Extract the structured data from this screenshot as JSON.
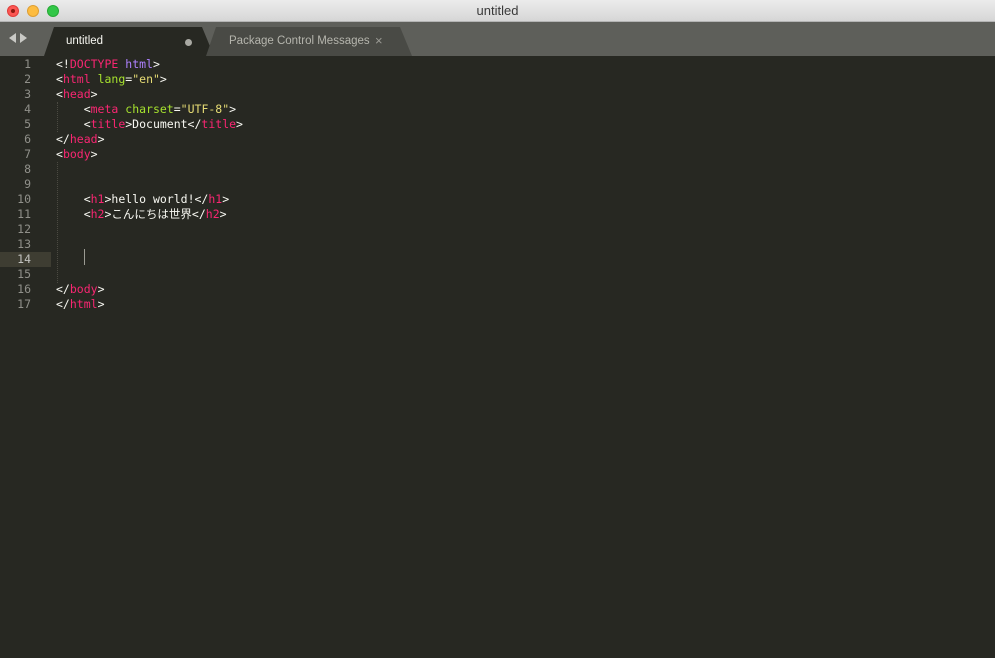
{
  "window": {
    "title": "untitled"
  },
  "tabs": [
    {
      "label": "untitled",
      "active": true,
      "dirty": true
    },
    {
      "label": "Package Control Messages",
      "active": false,
      "close_glyph": "×"
    }
  ],
  "editor": {
    "current_line": 14,
    "theme_colors": {
      "background": "#272822",
      "tag": "#f92672",
      "attr": "#a6e22e",
      "string": "#e6db74",
      "keyword": "#ae81ff",
      "text": "#f8f8f2"
    },
    "lines": [
      {
        "num": "1",
        "tokens": [
          {
            "t": "<!",
            "c": "white"
          },
          {
            "t": "DOCTYPE",
            "c": "pink"
          },
          {
            "t": " ",
            "c": "white"
          },
          {
            "t": "html",
            "c": "purple"
          },
          {
            "t": ">",
            "c": "white"
          }
        ]
      },
      {
        "num": "2",
        "tokens": [
          {
            "t": "<",
            "c": "white"
          },
          {
            "t": "html",
            "c": "pink"
          },
          {
            "t": " ",
            "c": "white"
          },
          {
            "t": "lang",
            "c": "green"
          },
          {
            "t": "=",
            "c": "white"
          },
          {
            "t": "\"en\"",
            "c": "yellow"
          },
          {
            "t": ">",
            "c": "white"
          }
        ]
      },
      {
        "num": "3",
        "tokens": [
          {
            "t": "<",
            "c": "white"
          },
          {
            "t": "head",
            "c": "pink"
          },
          {
            "t": ">",
            "c": "white"
          }
        ]
      },
      {
        "num": "4",
        "tokens": [
          {
            "t": "    <",
            "c": "white"
          },
          {
            "t": "meta",
            "c": "pink"
          },
          {
            "t": " ",
            "c": "white"
          },
          {
            "t": "charset",
            "c": "green"
          },
          {
            "t": "=",
            "c": "white"
          },
          {
            "t": "\"UTF-8\"",
            "c": "yellow"
          },
          {
            "t": ">",
            "c": "white"
          }
        ]
      },
      {
        "num": "5",
        "tokens": [
          {
            "t": "    <",
            "c": "white"
          },
          {
            "t": "title",
            "c": "pink"
          },
          {
            "t": ">Document</",
            "c": "white"
          },
          {
            "t": "title",
            "c": "pink"
          },
          {
            "t": ">",
            "c": "white"
          }
        ]
      },
      {
        "num": "6",
        "tokens": [
          {
            "t": "</",
            "c": "white"
          },
          {
            "t": "head",
            "c": "pink"
          },
          {
            "t": ">",
            "c": "white"
          }
        ]
      },
      {
        "num": "7",
        "tokens": [
          {
            "t": "<",
            "c": "white"
          },
          {
            "t": "body",
            "c": "pink"
          },
          {
            "t": ">",
            "c": "white"
          }
        ]
      },
      {
        "num": "8",
        "tokens": []
      },
      {
        "num": "9",
        "tokens": []
      },
      {
        "num": "10",
        "tokens": [
          {
            "t": "    <",
            "c": "white"
          },
          {
            "t": "h1",
            "c": "pink"
          },
          {
            "t": ">hello world!</",
            "c": "white"
          },
          {
            "t": "h1",
            "c": "pink"
          },
          {
            "t": ">",
            "c": "white"
          }
        ]
      },
      {
        "num": "11",
        "tokens": [
          {
            "t": "    <",
            "c": "white"
          },
          {
            "t": "h2",
            "c": "pink"
          },
          {
            "t": ">こんにちは世界</",
            "c": "white"
          },
          {
            "t": "h2",
            "c": "pink"
          },
          {
            "t": ">",
            "c": "white"
          }
        ]
      },
      {
        "num": "12",
        "tokens": []
      },
      {
        "num": "13",
        "tokens": []
      },
      {
        "num": "14",
        "tokens": []
      },
      {
        "num": "15",
        "tokens": []
      },
      {
        "num": "16",
        "tokens": [
          {
            "t": "</",
            "c": "white"
          },
          {
            "t": "body",
            "c": "pink"
          },
          {
            "t": ">",
            "c": "white"
          }
        ]
      },
      {
        "num": "17",
        "tokens": [
          {
            "t": "</",
            "c": "white"
          },
          {
            "t": "html",
            "c": "pink"
          },
          {
            "t": ">",
            "c": "white"
          }
        ]
      }
    ]
  }
}
